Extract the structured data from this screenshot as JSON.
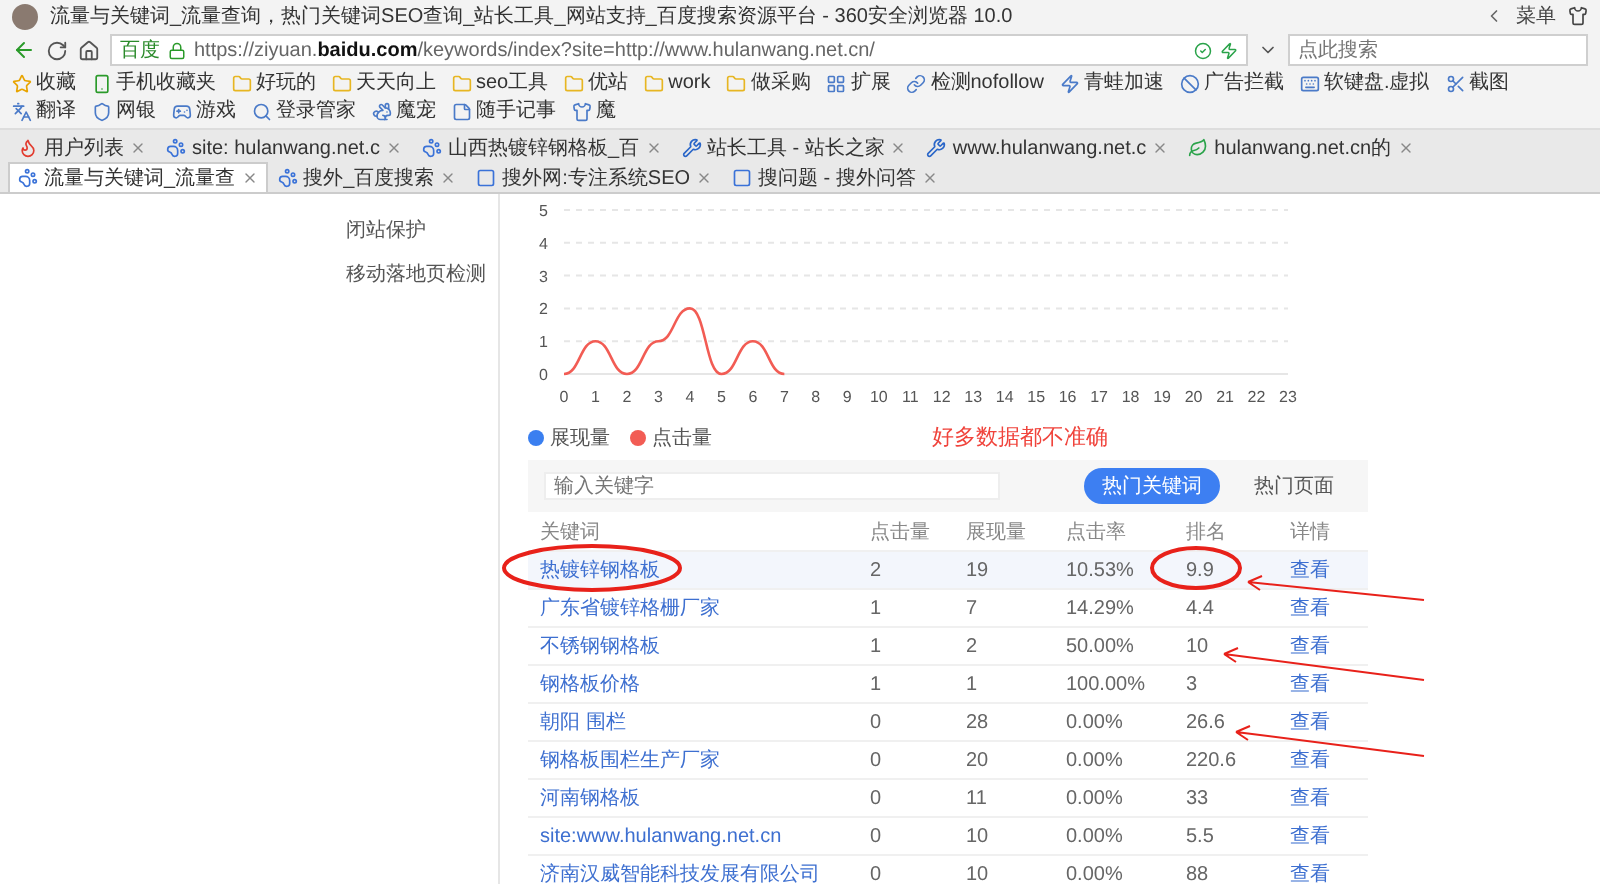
{
  "browser": {
    "title": "流量与关键词_流量查询，热门关键词SEO查询_站长工具_网站支持_百度搜索资源平台 - 360安全浏览器 10.0",
    "menu_label": "菜单",
    "url_badge": "百度",
    "url": "https://ziyuan.**baidu.com**/keywords/index?site=http://www.hulanwang.net.cn/",
    "search_placeholder": "点此搜索"
  },
  "bookmarks": [
    {
      "label": "收藏",
      "kind": "star"
    },
    {
      "label": "手机收藏夹",
      "kind": "phone"
    },
    {
      "label": "好玩的",
      "kind": "folder"
    },
    {
      "label": "天天向上",
      "kind": "folder"
    },
    {
      "label": "seo工具",
      "kind": "folder"
    },
    {
      "label": "优站",
      "kind": "folder"
    },
    {
      "label": "work",
      "kind": "folder"
    },
    {
      "label": "做采购",
      "kind": "folder"
    }
  ],
  "extensions": [
    {
      "label": "扩展",
      "kind": "grid"
    },
    {
      "label": "检测nofollow",
      "kind": "link"
    },
    {
      "label": "青蛙加速",
      "kind": "frog"
    },
    {
      "label": "广告拦截",
      "kind": "block"
    },
    {
      "label": "软键盘.虚拟",
      "kind": "keyboard"
    },
    {
      "label": "截图",
      "kind": "scissors"
    },
    {
      "label": "翻译",
      "kind": "translate"
    },
    {
      "label": "网银",
      "kind": "shield"
    },
    {
      "label": "游戏",
      "kind": "game"
    },
    {
      "label": "登录管家",
      "kind": "search"
    },
    {
      "label": "魔宠",
      "kind": "pet"
    },
    {
      "label": "随手记事",
      "kind": "note"
    },
    {
      "label": "魔",
      "kind": "v"
    }
  ],
  "tabs": [
    {
      "label": "用户列表",
      "kind": "flame",
      "selected": false
    },
    {
      "label": "site: hulanwang.net.c",
      "kind": "paw",
      "selected": false
    },
    {
      "label": "山西热镀锌钢格板_百",
      "kind": "paw",
      "selected": false
    },
    {
      "label": "站长工具 - 站长之家",
      "kind": "tool",
      "selected": false
    },
    {
      "label": "www.hulanwang.net.c",
      "kind": "tool",
      "selected": false
    },
    {
      "label": "hulanwang.net.cn的",
      "kind": "leaf",
      "selected": false
    },
    {
      "label": "流量与关键词_流量查",
      "kind": "paw",
      "selected": true
    },
    {
      "label": "搜外_百度搜索",
      "kind": "paw",
      "selected": false
    },
    {
      "label": "搜外网:专注系统SEO",
      "kind": "square",
      "selected": false
    },
    {
      "label": "搜问题 - 搜外问答",
      "kind": "square",
      "selected": false
    }
  ],
  "sidebar": {
    "items": [
      {
        "label": "闭站保护"
      },
      {
        "label": "移动落地页检测"
      }
    ]
  },
  "chart": {
    "note": "好多数据都不准确",
    "chart_data": {
      "type": "line",
      "x": [
        0,
        1,
        2,
        3,
        4,
        5,
        6,
        7
      ],
      "xlim": [
        0,
        23
      ],
      "ylim": [
        0,
        5
      ],
      "grid": true,
      "yticks": [
        0,
        1,
        2,
        3,
        4,
        5
      ],
      "xticks": [
        0,
        1,
        2,
        3,
        4,
        5,
        6,
        7,
        8,
        9,
        10,
        11,
        12,
        13,
        14,
        15,
        16,
        17,
        18,
        19,
        20,
        21,
        22,
        23
      ],
      "series": [
        {
          "name": "展现量",
          "color": "#3a7ff0",
          "values": [
            null,
            null,
            null,
            null,
            null,
            null,
            null,
            null
          ]
        },
        {
          "name": "点击量",
          "color": "#f25c54",
          "values": [
            0,
            1,
            0,
            1,
            2,
            0,
            1,
            0
          ]
        }
      ]
    }
  },
  "keywords": {
    "search_placeholder": "输入关键字",
    "views": [
      {
        "label": "热门关键词",
        "selected": true
      },
      {
        "label": "热门页面",
        "selected": false
      }
    ],
    "columns": [
      "关键词",
      "点击量",
      "展现量",
      "点击率",
      "排名",
      "详情"
    ],
    "rows": [
      {
        "keyword": "热镀锌钢格板",
        "clicks": "2",
        "views": "19",
        "ctr": "10.53%",
        "rank": "9.9",
        "action": "查看",
        "selected": true
      },
      {
        "keyword": "广东省镀锌格栅厂家",
        "clicks": "1",
        "views": "7",
        "ctr": "14.29%",
        "rank": "4.4",
        "action": "查看",
        "selected": false
      },
      {
        "keyword": "不锈钢钢格板",
        "clicks": "1",
        "views": "2",
        "ctr": "50.00%",
        "rank": "10",
        "action": "查看",
        "selected": false
      },
      {
        "keyword": "钢格板价格",
        "clicks": "1",
        "views": "1",
        "ctr": "100.00%",
        "rank": "3",
        "action": "查看",
        "selected": false
      },
      {
        "keyword": "朝阳 围栏",
        "clicks": "0",
        "views": "28",
        "ctr": "0.00%",
        "rank": "26.6",
        "action": "查看",
        "selected": false
      },
      {
        "keyword": "钢格板围栏生产厂家",
        "clicks": "0",
        "views": "20",
        "ctr": "0.00%",
        "rank": "220.6",
        "action": "查看",
        "selected": false
      },
      {
        "keyword": "河南钢格板",
        "clicks": "0",
        "views": "11",
        "ctr": "0.00%",
        "rank": "33",
        "action": "查看",
        "selected": false
      },
      {
        "keyword": "site:www.hulanwang.net.cn",
        "clicks": "0",
        "views": "10",
        "ctr": "0.00%",
        "rank": "5.5",
        "action": "查看",
        "selected": false
      },
      {
        "keyword": "济南汉威智能科技发展有限公司",
        "clicks": "0",
        "views": "10",
        "ctr": "0.00%",
        "rank": "88",
        "action": "查看",
        "selected": false
      }
    ]
  }
}
